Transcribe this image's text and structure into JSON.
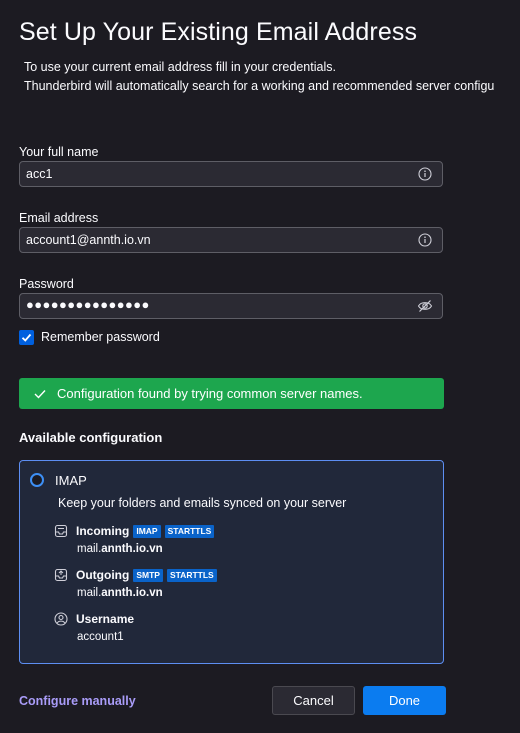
{
  "header": {
    "title": "Set Up Your Existing Email Address",
    "intro_line1": "To use your current email address fill in your credentials.",
    "intro_line2": "Thunderbird will automatically search for a working and recommended server configu"
  },
  "form": {
    "full_name_label": "Your full name",
    "full_name_value": "acc1",
    "email_label": "Email address",
    "email_value": "account1@annth.io.vn",
    "password_label": "Password",
    "password_masked": "●●●●●●●●●●●●●●●",
    "remember_label": "Remember password",
    "remember_checked": true
  },
  "status": {
    "message": "Configuration found by trying common server names.",
    "color": "#1da64e"
  },
  "config": {
    "heading": "Available configuration",
    "protocol": "IMAP",
    "description": "Keep your folders and emails synced on your server",
    "incoming": {
      "label": "Incoming",
      "badge1": "IMAP",
      "badge2": "STARTTLS",
      "host_prefix": "mail.",
      "host_bold": "annth.io.vn"
    },
    "outgoing": {
      "label": "Outgoing",
      "badge1": "SMTP",
      "badge2": "STARTTLS",
      "host_prefix": "mail.",
      "host_bold": "annth.io.vn"
    },
    "username": {
      "label": "Username",
      "value": "account1"
    }
  },
  "footer": {
    "configure_manually": "Configure manually",
    "cancel": "Cancel",
    "done": "Done"
  },
  "colors": {
    "accent": "#0b7cf0",
    "link": "#a99cf8",
    "background": "#1c1b22"
  }
}
